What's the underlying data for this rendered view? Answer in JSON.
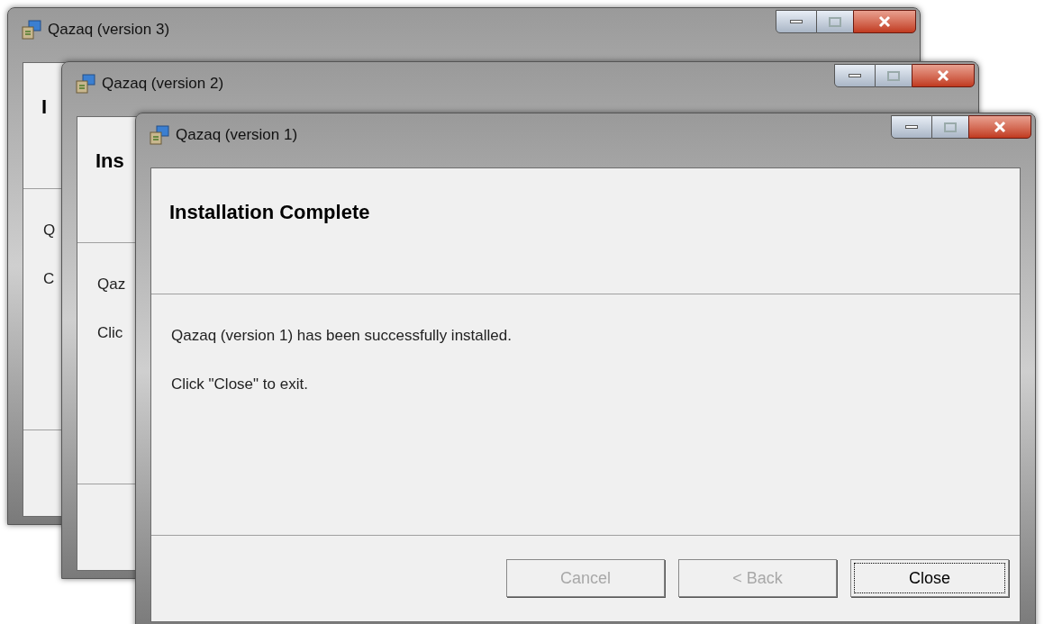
{
  "windows": [
    {
      "title": "Qazaq (version 3)",
      "heading": "I",
      "lines": [
        "Q",
        "C"
      ]
    },
    {
      "title": "Qazaq (version 2)",
      "heading": "Ins",
      "lines": [
        "Qaz",
        "Clic"
      ]
    },
    {
      "title": "Qazaq (version 1)",
      "heading": "Installation Complete",
      "lines": [
        "Qazaq (version 1) has been successfully installed.",
        "Click \"Close\" to exit."
      ],
      "buttons": [
        {
          "label": "Cancel",
          "disabled": true,
          "focused": false
        },
        {
          "label": "< Back",
          "disabled": true,
          "focused": false
        },
        {
          "label": "Close",
          "disabled": false,
          "focused": true
        }
      ]
    }
  ]
}
